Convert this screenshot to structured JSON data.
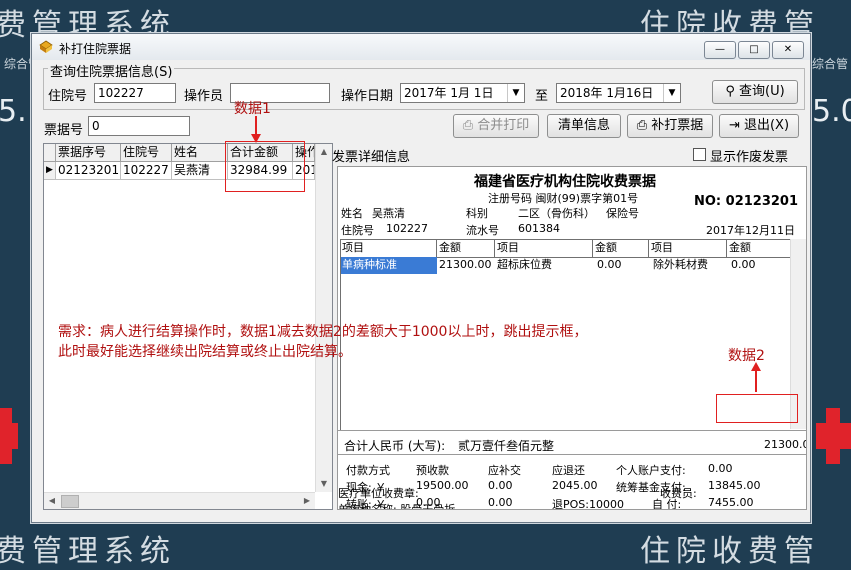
{
  "background": {
    "text_top_left": "费管理系统",
    "text_top_right": "住院收费管",
    "text_bottom_left": "费管理系统",
    "text_bottom_right": "住院收费管",
    "small_left": "综合管",
    "small_right": "综合管",
    "num_left": "5.",
    "num_right": "5.0"
  },
  "window": {
    "title": "补打住院票据",
    "title_icon": "app-icon",
    "min_glyph": "—",
    "max_glyph": "□",
    "close_glyph": "✕"
  },
  "query": {
    "legend": "查询住院票据信息(S)",
    "admission_no_label": "住院号",
    "admission_no_value": "102227",
    "operator_label": "操作员",
    "operator_value": "",
    "date_label": "操作日期",
    "date_from": "2017年 1月 1日",
    "to_label": "至",
    "date_to": "2018年 1月16日",
    "query_button": "查询(U)"
  },
  "toolbar": {
    "receipt_no_label": "票据号",
    "receipt_no_value": "0",
    "merge_print": "合并打印",
    "clear_info": "清单信息",
    "reprint": "补打票据",
    "exit": "退出(X)"
  },
  "grid": {
    "columns": [
      "票据序号",
      "住院号",
      "姓名",
      "合计金额",
      "操作"
    ],
    "rows": [
      {
        "marker": "▶",
        "receipt_seq": "02123201",
        "admission_no": "102227",
        "name": "吴燕清",
        "total": "32984.99",
        "op": "201"
      }
    ]
  },
  "details": {
    "header": "发票详细信息",
    "show_void_label": "显示作废发票",
    "show_void_checked": false
  },
  "receipt": {
    "title": "福建省医疗机构住院收费票据",
    "reg_label": "注册号码 闽财(99)票字第01号",
    "no_label": "NO: 02123201",
    "name_label": "姓名",
    "name_value": "吴燕清",
    "dept_label": "科别",
    "dept_value": "二区（骨伤科）",
    "insurance_label": "保险号",
    "adm_label": "住院号",
    "adm_value": "102227",
    "serial_label": "流水号",
    "serial_value": "601384",
    "date": "2017年12月11日",
    "table_head": [
      "项目",
      "金额",
      "项目",
      "金额",
      "项目",
      "金额"
    ],
    "table_row": [
      "单病种标准",
      "21300.00",
      "超标床位费",
      "0.00",
      "除外耗材费",
      "0.00"
    ],
    "total_label": "合计人民币 (大写):",
    "total_words": "贰万壹仟叁佰元整",
    "total_value": "21300.00",
    "pay_method": "付款方式",
    "prepaid": "预收款",
    "supplement": "应补交",
    "refund": "应退还",
    "personal_account": "个人账户支付:",
    "personal_account_value": "0.00",
    "cash_label": "现金: ￥",
    "cash_prepaid": "19500.00",
    "cash_supplement": "0.00",
    "cash_refund": "2045.00",
    "pooled_label": "统筹基金支付:",
    "pooled_value": "13845.00",
    "transfer_label": "转账: ￥",
    "transfer_prepaid": "0.00",
    "transfer_supplement": "0.00",
    "refund_pos": "退POS:10000",
    "self_pay_label": "自  付:",
    "self_pay_value": "7455.00",
    "hospital_cashier": "医疗单位收费章:",
    "cashier": "收费员:",
    "disease_name": "单病种名称: 股骨干骨折"
  },
  "annotations": {
    "data1": "数据1",
    "data2": "数据2",
    "requirement_line1": "需求：病人进行结算操作时，数据1减去数据2的差额大于1000以上时，跳出提示框，",
    "requirement_line2": "此时最好能选择继续出院结算或终止出院结算。"
  }
}
